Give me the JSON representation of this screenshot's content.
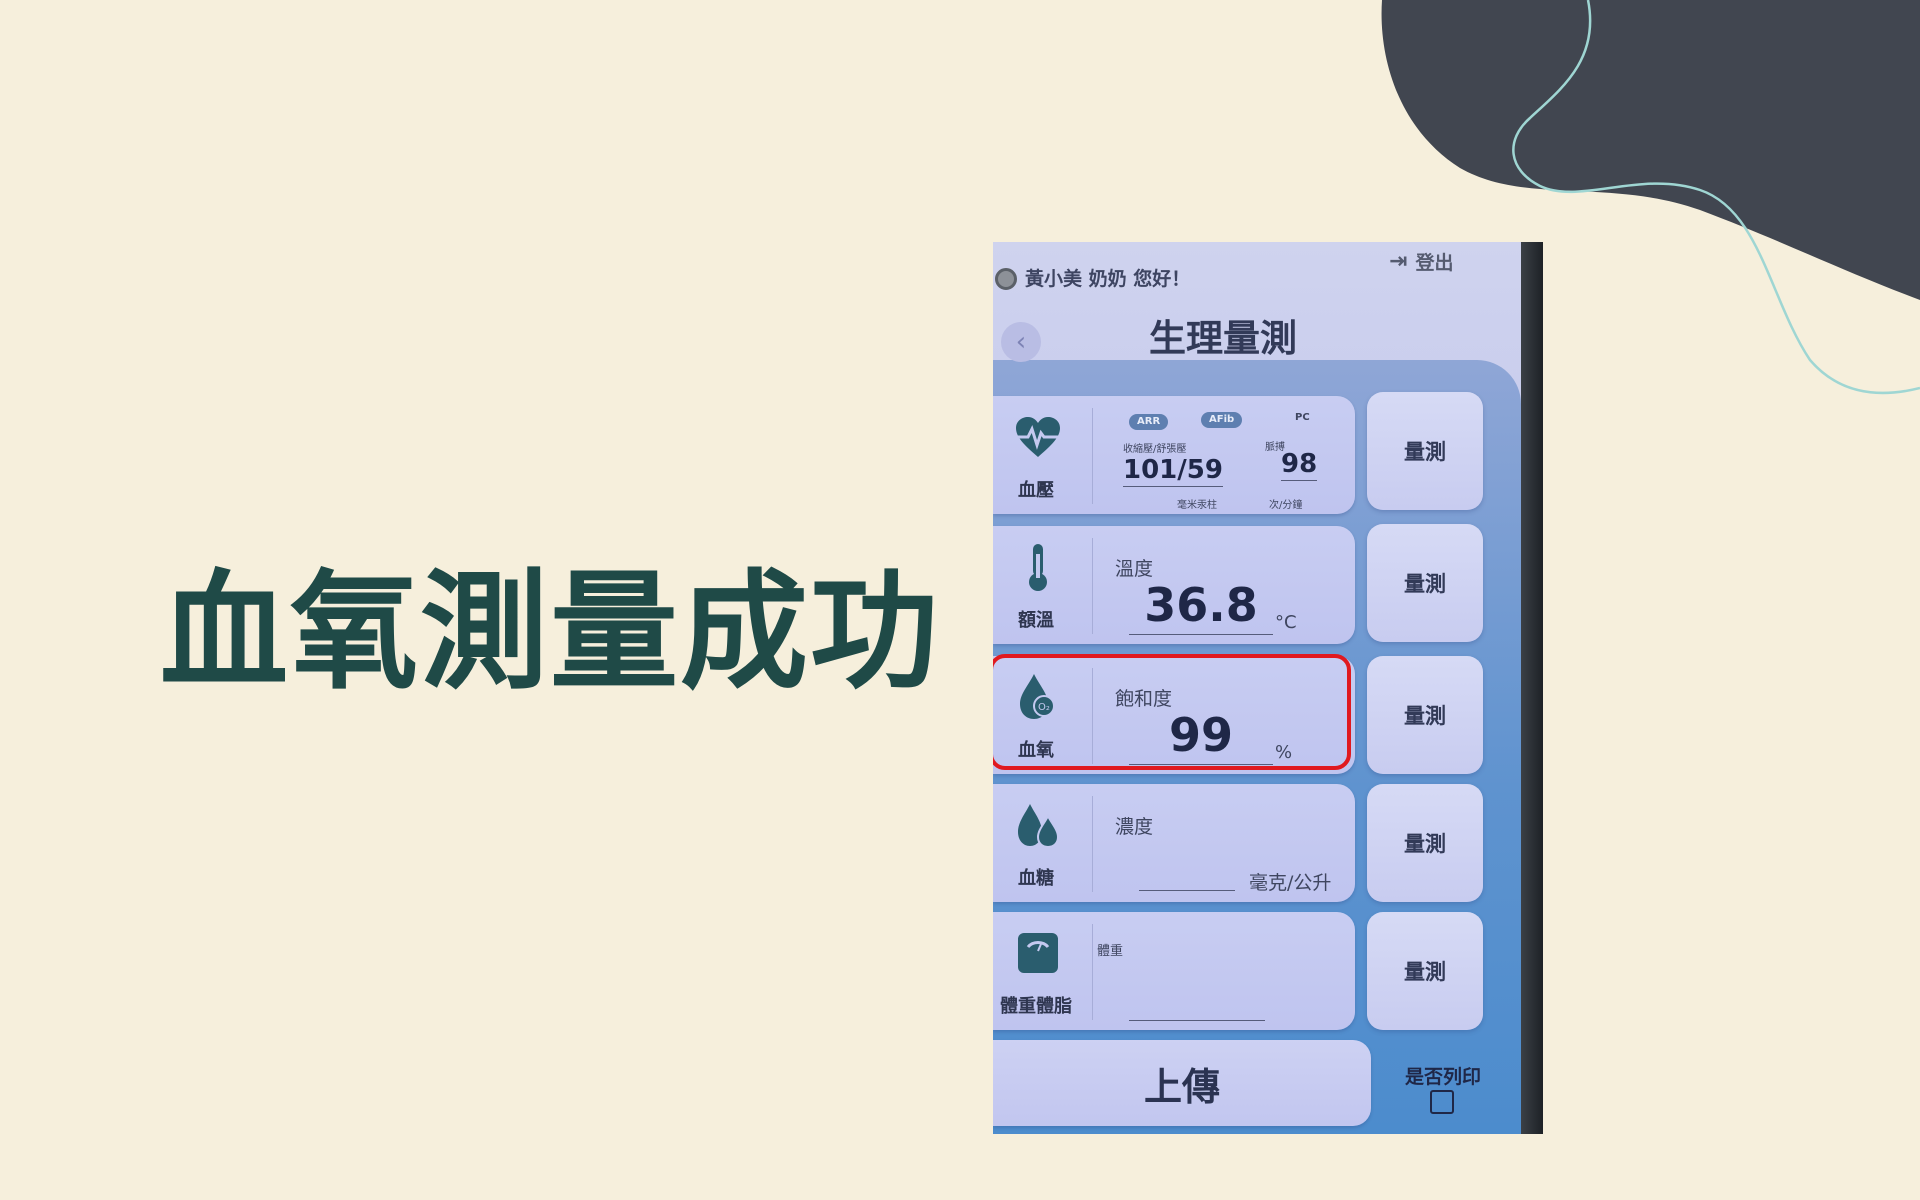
{
  "slide": {
    "title": "血氧測量成功"
  },
  "app": {
    "greeting": "黃小美 奶奶 您好！",
    "logout_label": "登出",
    "screen_title": "生理量測",
    "measure_label": "量測",
    "upload_label": "上傳",
    "print_label": "是否列印",
    "print_checked": false
  },
  "blood_pressure": {
    "category": "血壓",
    "badges": [
      "ARR",
      "AFib",
      "PC"
    ],
    "pressure_label": "收縮壓/舒張壓",
    "pressure_value": "101/59",
    "pressure_unit": "毫米汞柱",
    "pulse_label": "脈搏",
    "pulse_value": "98",
    "pulse_unit": "次/分鐘"
  },
  "temperature": {
    "category": "額溫",
    "label": "溫度",
    "value": "36.8",
    "unit": "°C"
  },
  "oxygen": {
    "category": "血氧",
    "label": "飽和度",
    "value": "99",
    "unit": "%",
    "highlighted": true
  },
  "glucose": {
    "category": "血糖",
    "label": "濃度",
    "value": "",
    "unit": "毫克/公升"
  },
  "weight": {
    "category": "體重體脂",
    "label": "體重",
    "value": ""
  },
  "colors": {
    "background": "#f6efdc",
    "title": "#1f4a47",
    "highlight": "#e0191f",
    "decor_dark": "#414650",
    "decor_line": "#9fd6d3"
  }
}
